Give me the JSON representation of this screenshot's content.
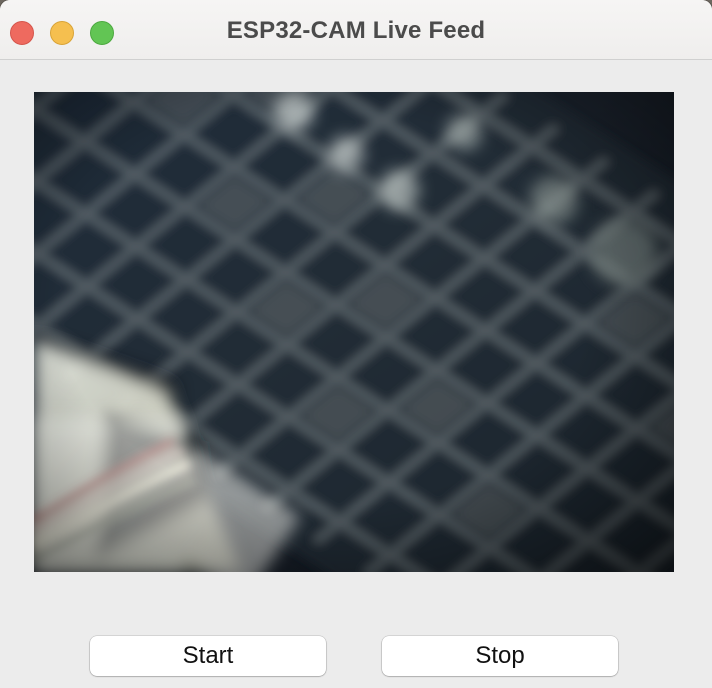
{
  "window": {
    "title": "ESP32-CAM Live Feed"
  },
  "controls": {
    "start_label": "Start",
    "stop_label": "Stop"
  },
  "traffic_lights": {
    "close_color": "#ee6a5f",
    "minimize_color": "#f5bf4f",
    "zoom_color": "#62c554"
  }
}
